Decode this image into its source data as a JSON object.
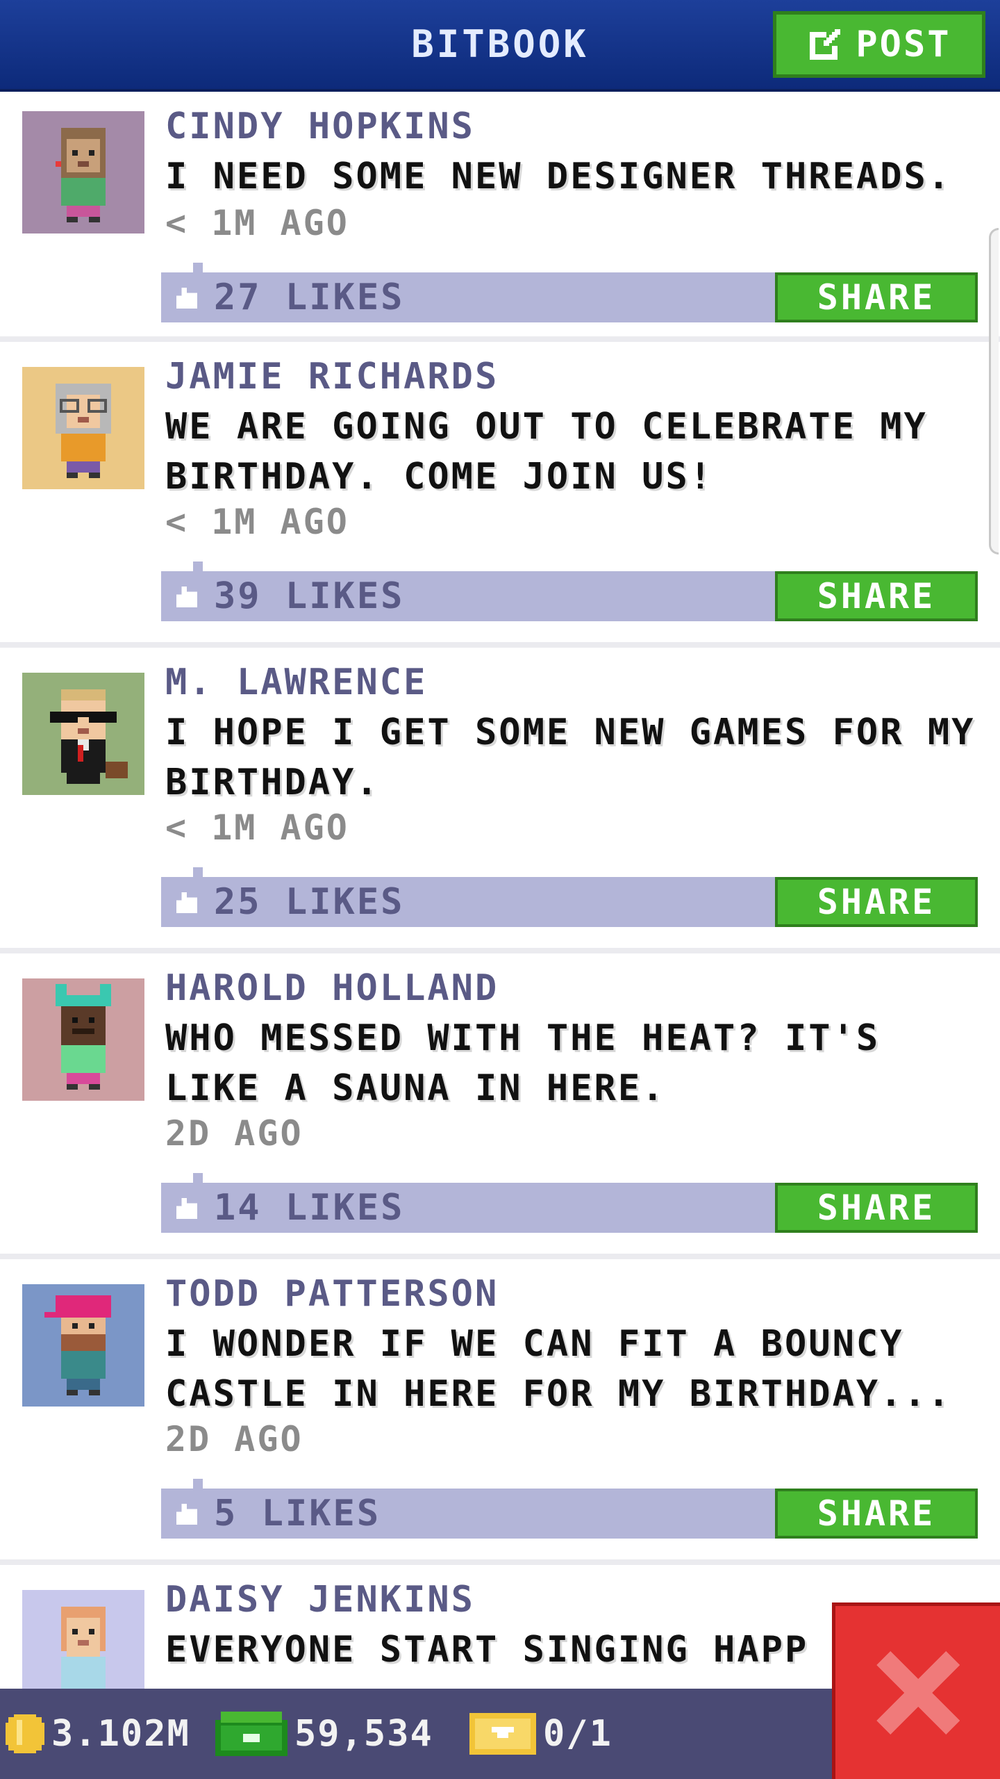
{
  "header": {
    "title": "BITBOOK",
    "post_label": "POST"
  },
  "share_label": "SHARE",
  "posts": [
    {
      "author": "CINDY HOPKINS",
      "message": "I NEED SOME NEW DESIGNER THREADS.",
      "time": "< 1M AGO",
      "likes": "27 LIKES",
      "avatar": {
        "bg": "#a48aa8",
        "hair": "#8c6a4a",
        "skin": "#c8a07a",
        "shirt": "#4faa6a",
        "pants": "#c8569a",
        "accessory": "none"
      }
    },
    {
      "author": "JAMIE RICHARDS",
      "message": "WE ARE GOING OUT TO CELEBRATE MY BIRTHDAY. COME JOIN US!",
      "time": "< 1M AGO",
      "likes": "39 LIKES",
      "avatar": {
        "bg": "#ebc885",
        "hair": "#b8b8b8",
        "skin": "#f0c8a0",
        "shirt": "#e89a2a",
        "pants": "#7a5aa8",
        "accessory": "glasses"
      }
    },
    {
      "author": "M. LAWRENCE",
      "message": "I HOPE I GET SOME NEW GAMES FOR MY BIRTHDAY.",
      "time": "< 1M AGO",
      "likes": "25 LIKES",
      "avatar": {
        "bg": "#94b07a",
        "hair": "#d8b878",
        "skin": "#f0c8a0",
        "shirt": "#1a1a1a",
        "pants": "#1a1a1a",
        "accessory": "sunglasses"
      }
    },
    {
      "author": "HAROLD HOLLAND",
      "message": "WHO MESSED WITH THE HEAT? IT'S LIKE A SAUNA IN HERE.",
      "time": "2D AGO",
      "likes": "14 LIKES",
      "avatar": {
        "bg": "#cc9fa2",
        "hair": "#3ac8b0",
        "skin": "#5a3a28",
        "shirt": "#6ad890",
        "pants": "#d84a9a",
        "accessory": "ears"
      }
    },
    {
      "author": "TODD PATTERSON",
      "message": "I WONDER IF WE CAN FIT A BOUNCY CASTLE IN HERE FOR MY BIRTHDAY...",
      "time": "2D AGO",
      "likes": "5 LIKES",
      "avatar": {
        "bg": "#7b96c7",
        "hair": "#e0287a",
        "skin": "#e8b890",
        "shirt": "#3a8a8a",
        "pants": "#3a6a8a",
        "accessory": "cap"
      }
    },
    {
      "author": "DAISY JENKINS",
      "message": "EVERYONE START SINGING HAPP",
      "time": "",
      "likes": "",
      "avatar": {
        "bg": "#c8c8ec",
        "hair": "#e8a070",
        "skin": "#f0c8a0",
        "shirt": "#a8d8e8",
        "pants": "#a8d8e8",
        "accessory": "none"
      }
    }
  ],
  "status": {
    "coins": "3.102M",
    "cash": "59,534",
    "tickets": "0/1"
  },
  "colors": {
    "header": "#1d3f9a",
    "accent_green": "#49b832",
    "likes_bar": "#b3b5d8",
    "close": "#e53232",
    "status_bar": "#4a4a74"
  }
}
